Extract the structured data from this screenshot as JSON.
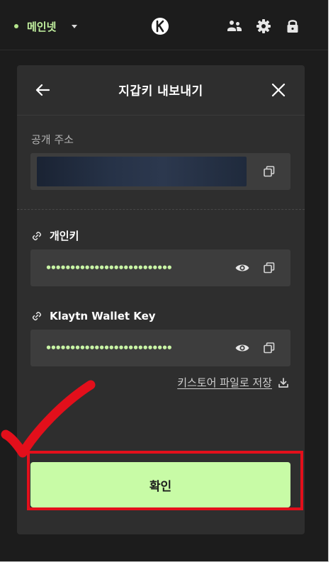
{
  "network": {
    "label": "메인넷",
    "dot_color": "#b4e58c"
  },
  "header_icons": [
    "logo-icon",
    "accounts-icon",
    "gear-icon",
    "lock-icon"
  ],
  "panel": {
    "title": "지갑키 내보내기",
    "public_address": {
      "label": "공개 주소",
      "value_hidden": true
    },
    "private_key": {
      "label": "개인키",
      "masked_value": "••••••••••••••••••••••••••"
    },
    "wallet_key": {
      "label": "Klaytn Wallet Key",
      "masked_value": "••••••••••••••••••••••••••"
    },
    "keystore_link": "키스토어 파일로 저장",
    "confirm_label": "확인"
  },
  "colors": {
    "accent": "#c8fba6",
    "highlight": "#e30f1b",
    "background": "#1c1c1c",
    "panel": "#2e2e2e"
  }
}
